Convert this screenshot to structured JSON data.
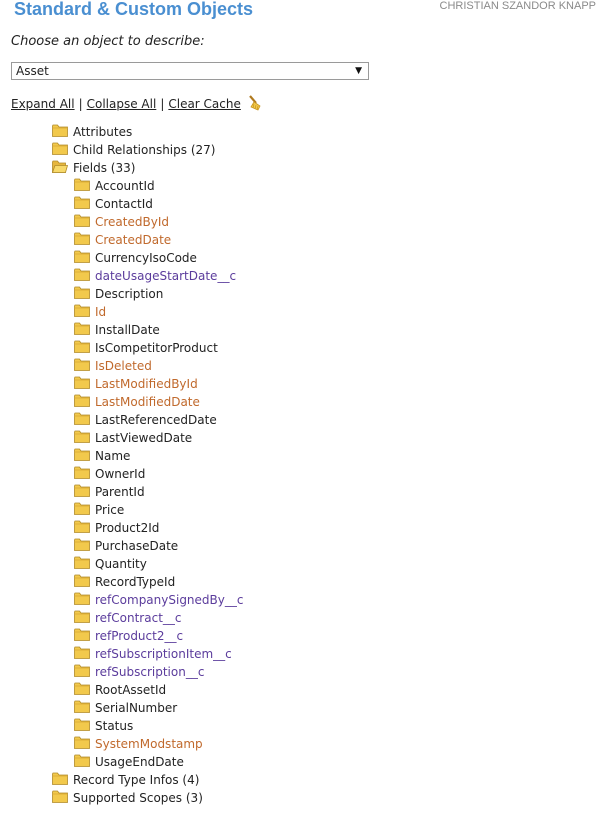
{
  "header": {
    "title": "Standard & Custom Objects",
    "user": "CHRISTIAN SZANDOR KNAPP"
  },
  "picker": {
    "prompt": "Choose an object to describe:",
    "selected": "Asset"
  },
  "actions": {
    "expand_all": "Expand All",
    "collapse_all": "Collapse All",
    "clear_cache": "Clear Cache",
    "separator": "|"
  },
  "colors": {
    "title": "#4a8fd1",
    "standard_field": "#222222",
    "system_field": "#c0692c",
    "custom_field": "#5b3c9c",
    "folder": "#f2c94c"
  },
  "tree": {
    "top": [
      {
        "label": "Attributes",
        "open": false
      },
      {
        "label": "Child Relationships (27)",
        "open": false
      },
      {
        "label": "Fields (33)",
        "open": true
      }
    ],
    "fields": [
      {
        "label": "AccountId",
        "kind": "standard"
      },
      {
        "label": "ContactId",
        "kind": "standard"
      },
      {
        "label": "CreatedById",
        "kind": "system"
      },
      {
        "label": "CreatedDate",
        "kind": "system"
      },
      {
        "label": "CurrencyIsoCode",
        "kind": "standard"
      },
      {
        "label": "dateUsageStartDate__c",
        "kind": "custom"
      },
      {
        "label": "Description",
        "kind": "standard"
      },
      {
        "label": "Id",
        "kind": "system"
      },
      {
        "label": "InstallDate",
        "kind": "standard"
      },
      {
        "label": "IsCompetitorProduct",
        "kind": "standard"
      },
      {
        "label": "IsDeleted",
        "kind": "system"
      },
      {
        "label": "LastModifiedById",
        "kind": "system"
      },
      {
        "label": "LastModifiedDate",
        "kind": "system"
      },
      {
        "label": "LastReferencedDate",
        "kind": "standard"
      },
      {
        "label": "LastViewedDate",
        "kind": "standard"
      },
      {
        "label": "Name",
        "kind": "standard"
      },
      {
        "label": "OwnerId",
        "kind": "standard"
      },
      {
        "label": "ParentId",
        "kind": "standard"
      },
      {
        "label": "Price",
        "kind": "standard"
      },
      {
        "label": "Product2Id",
        "kind": "standard"
      },
      {
        "label": "PurchaseDate",
        "kind": "standard"
      },
      {
        "label": "Quantity",
        "kind": "standard"
      },
      {
        "label": "RecordTypeId",
        "kind": "standard"
      },
      {
        "label": "refCompanySignedBy__c",
        "kind": "custom"
      },
      {
        "label": "refContract__c",
        "kind": "custom"
      },
      {
        "label": "refProduct2__c",
        "kind": "custom"
      },
      {
        "label": "refSubscriptionItem__c",
        "kind": "custom"
      },
      {
        "label": "refSubscription__c",
        "kind": "custom"
      },
      {
        "label": "RootAssetId",
        "kind": "standard"
      },
      {
        "label": "SerialNumber",
        "kind": "standard"
      },
      {
        "label": "Status",
        "kind": "standard"
      },
      {
        "label": "SystemModstamp",
        "kind": "system"
      },
      {
        "label": "UsageEndDate",
        "kind": "standard"
      }
    ],
    "bottom": [
      {
        "label": "Record Type Infos (4)",
        "open": false
      },
      {
        "label": "Supported Scopes (3)",
        "open": false
      }
    ]
  }
}
